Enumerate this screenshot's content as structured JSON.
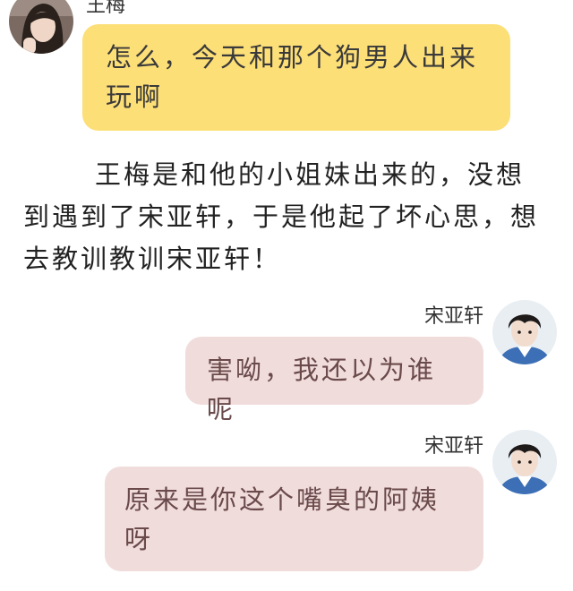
{
  "chat": {
    "messages": [
      {
        "sender": "王梅",
        "side": "left",
        "text": "怎么，今天和那个狗男人出来玩啊",
        "bubble_color": "#fddf78"
      },
      {
        "sender": "宋亚轩",
        "side": "right",
        "text": "害呦，我还以为谁呢",
        "bubble_color": "#f1dcdc"
      },
      {
        "sender": "宋亚轩",
        "side": "right",
        "text": "原来是你这个嘴臭的阿姨呀",
        "bubble_color": "#f1dcdc"
      }
    ],
    "narration": "王梅是和他的小姐妹出来的，没想到遇到了宋亚轩，于是他起了坏心思，想去教训教训宋亚轩！"
  },
  "avatars": {
    "wangmei": "avatar-girl-icon",
    "songyaxuan": "avatar-boy-icon"
  }
}
